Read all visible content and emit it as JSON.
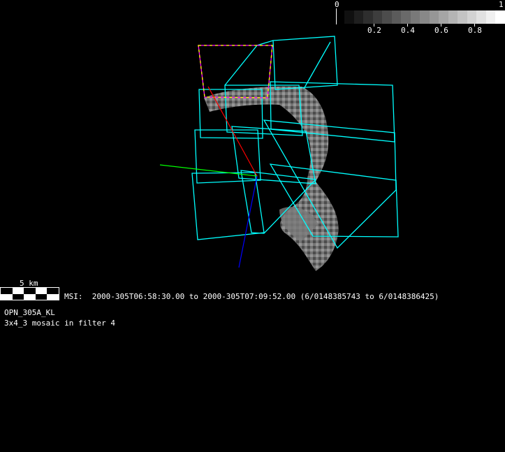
{
  "colorbar": {
    "min_label": "0",
    "max_label": "1",
    "ticks": [
      "0.2",
      "0.4",
      "0.6",
      "0.8"
    ],
    "steps": 17
  },
  "scale_bar": {
    "label": "5 km"
  },
  "info": {
    "instrument_line": "MSI:  2000-305T06:58:30.00 to 2000-305T07:09:52.00 (6/0148385743 to 6/0148386425)",
    "observation": "OPN_305A_KL",
    "mosaic": "3x4_3 mosaic in filter 4"
  },
  "colors": {
    "footprint": "#00ffff",
    "selected_a": "#ff00ff",
    "selected_b": "#ffff00",
    "axis_x": "#ff0000",
    "axis_y": "#00ff00",
    "axis_z": "#0000ff"
  }
}
